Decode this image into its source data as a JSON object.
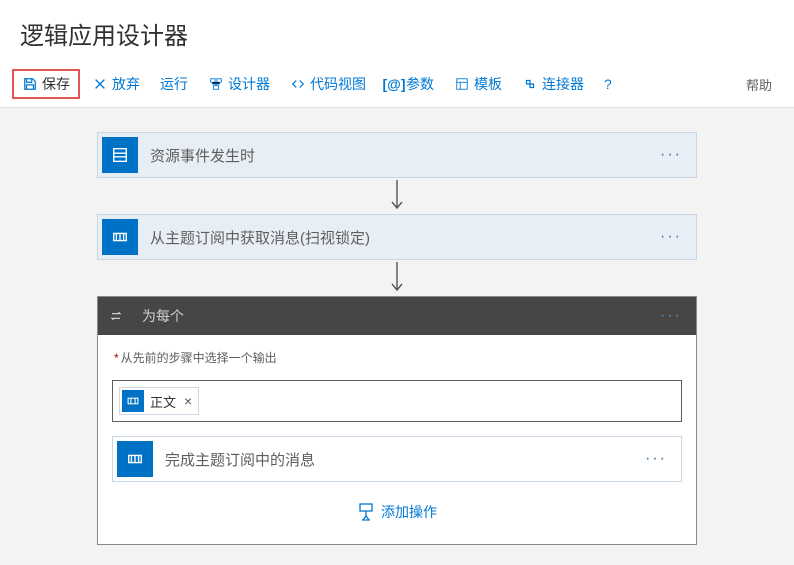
{
  "page": {
    "title": "逻辑应用设计器"
  },
  "toolbar": {
    "save": "保存",
    "discard": "放弃",
    "run": "运行",
    "designer": "设计器",
    "codeView": "代码视图",
    "parameters": "参数",
    "templates": "模板",
    "connectors": "连接器",
    "helpMark": "?",
    "help": "帮助"
  },
  "flow": {
    "trigger": {
      "title": "资源事件发生时"
    },
    "step2": {
      "title": "从主题订阅中获取消息(扫视锁定)"
    },
    "foreach": {
      "title": "为每个",
      "fieldLabel": "从先前的步骤中选择一个输出",
      "token": "正文",
      "innerStep": {
        "title": "完成主题订阅中的消息"
      },
      "addAction": "添加操作"
    }
  }
}
